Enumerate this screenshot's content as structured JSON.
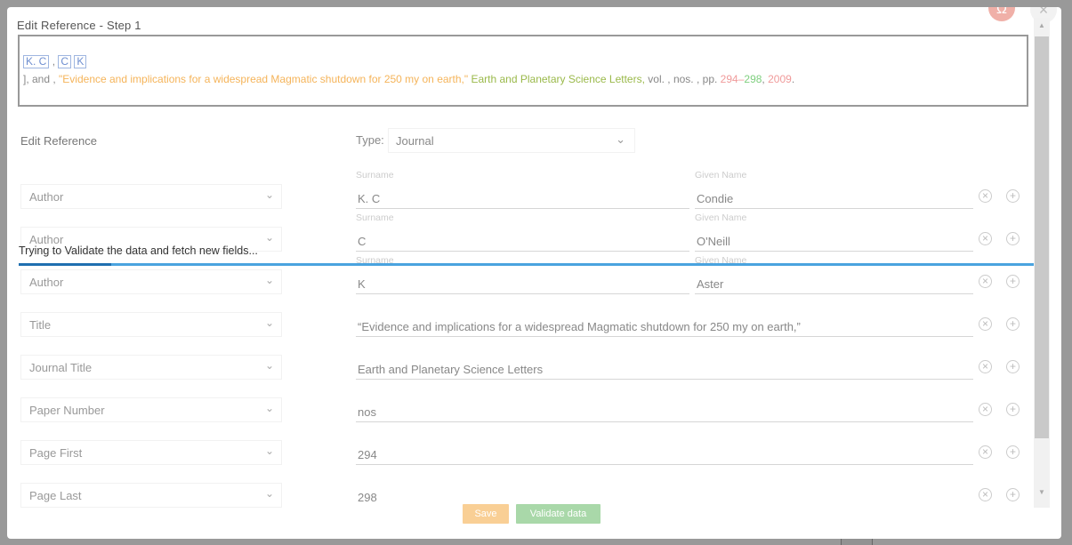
{
  "modal": {
    "title": "Edit Reference - Step 1",
    "help_icon": "omega-icon",
    "close_icon": "close-icon"
  },
  "preview": {
    "author1": "K. C",
    "sep1": ",",
    "author2a": "C",
    "author2b": "K",
    "lead": "], and ,",
    "title": "\"Evidence and implications for a widespread Magmatic shutdown for 250 my on earth,\"",
    "journal": "Earth and Planetary Science Letters,",
    "vol": "vol. , nos. , pp.",
    "page_first": "294",
    "dash": "–",
    "page_last": "298",
    "comma": ",",
    "year": "2009",
    "period": "."
  },
  "form": {
    "section_label": "Edit Reference",
    "type_label": "Type:",
    "type_value": "Journal",
    "surname_label": "Surname",
    "given_label": "Given Name",
    "rows": [
      {
        "field": "Author",
        "surname": "K. C",
        "given": "Condie"
      },
      {
        "field": "Author",
        "surname": "C",
        "given": "O'Neill"
      },
      {
        "field": "Author",
        "surname": "K",
        "given": "Aster"
      },
      {
        "field": "Title",
        "value": "“Evidence and implications for a widespread Magmatic shutdown for 250 my on earth,”"
      },
      {
        "field": "Journal Title",
        "value": "Earth and Planetary Science Letters"
      },
      {
        "field": "Paper Number",
        "value": "nos"
      },
      {
        "field": "Page First",
        "value": "294"
      },
      {
        "field": "Page Last",
        "value": "298"
      }
    ]
  },
  "status": {
    "text": "Trying to Validate the data and fetch new fields...",
    "progress_percent": 9
  },
  "buttons": {
    "save": "Save",
    "validate": "Validate data"
  },
  "colors": {
    "progress": "#4aa3df",
    "save": "#f9cf95",
    "validate": "#a9d8a9",
    "title_orange": "#f5b45a",
    "journal_green": "#9ab94a",
    "page_pink": "#f09a9a"
  }
}
